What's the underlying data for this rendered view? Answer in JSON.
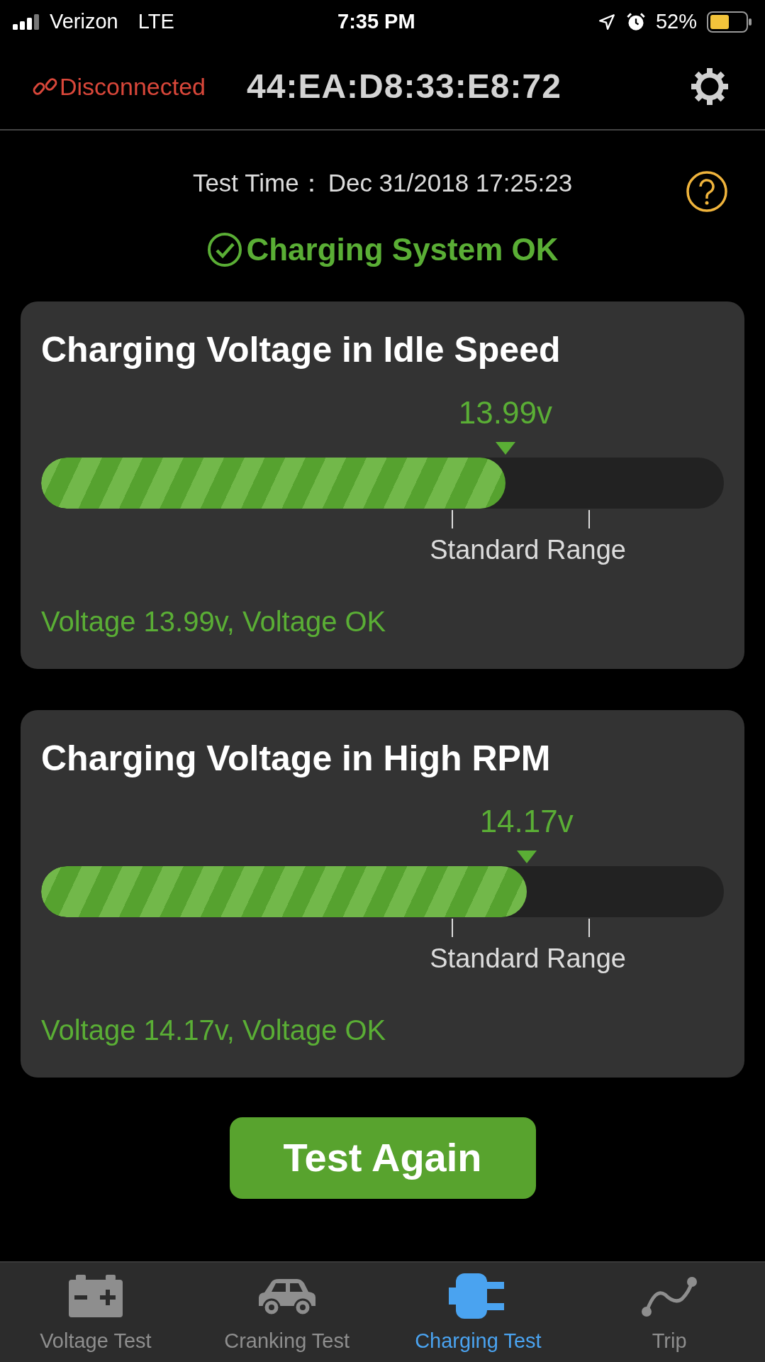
{
  "status_bar": {
    "carrier": "Verizon",
    "network": "LTE",
    "time": "7:35 PM",
    "battery_percent": "52%"
  },
  "header": {
    "connection": "Disconnected",
    "connected": false,
    "device_address": "44:EA:D8:33:E8:72"
  },
  "test_time": {
    "label": "Test Time：",
    "value": "Dec 31/2018 17:25:23"
  },
  "result": {
    "text": "Charging System OK",
    "ok": true
  },
  "cards": [
    {
      "title": "Charging Voltage in Idle Speed",
      "reading": "13.99v",
      "level": 0.68,
      "range_label": "Standard Range",
      "status": "Voltage 13.99v, Voltage OK",
      "ok": true
    },
    {
      "title": "Charging Voltage in High RPM",
      "reading": "14.17v",
      "level": 0.711,
      "range_label": "Standard Range",
      "status": "Voltage 14.17v, Voltage OK",
      "ok": true
    }
  ],
  "button": "Test Again",
  "tabs": [
    {
      "label": "Voltage Test",
      "kind": "battery",
      "selected": false
    },
    {
      "label": "Cranking Test",
      "kind": "car",
      "selected": false
    },
    {
      "label": "Charging Test",
      "kind": "plug",
      "selected": true
    },
    {
      "label": "Trip",
      "kind": "route",
      "selected": false
    }
  ]
}
